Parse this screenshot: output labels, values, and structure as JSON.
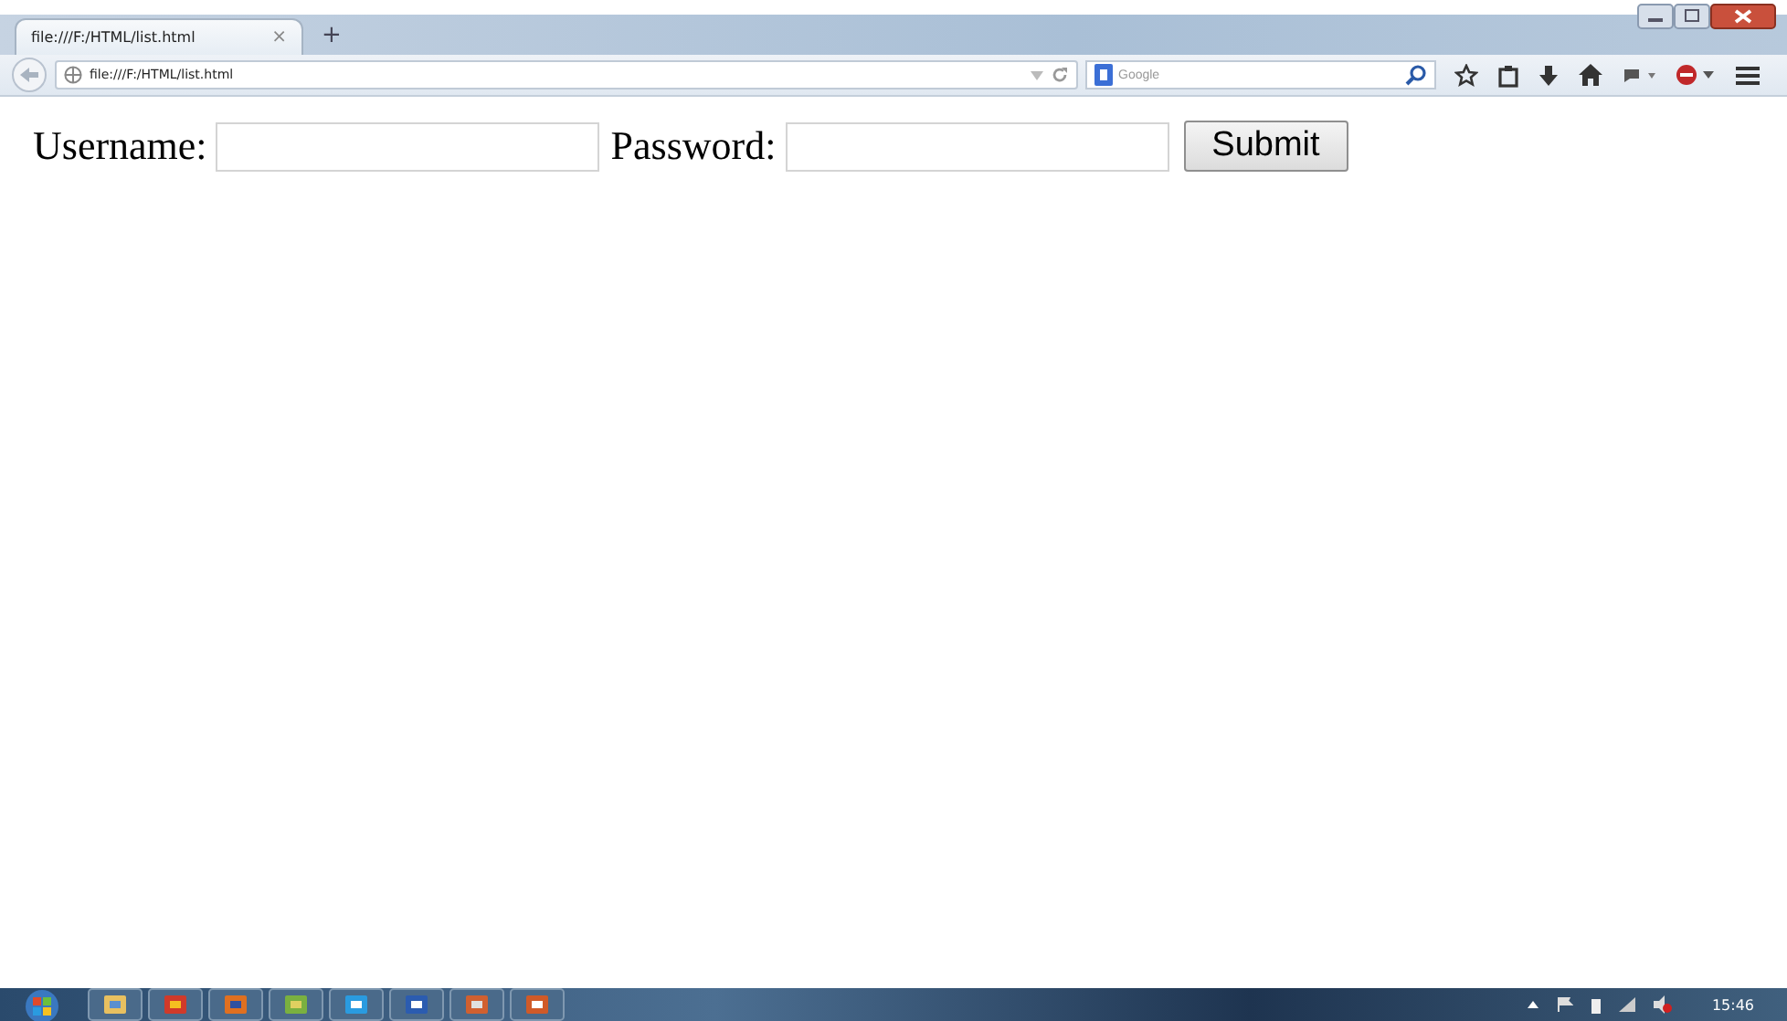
{
  "tab": {
    "title": "file:///F:/HTML/list.html",
    "close": "×",
    "new_tab": "+"
  },
  "address_bar": {
    "value": "file:///F:/HTML/list.html"
  },
  "search": {
    "placeholder": "Google"
  },
  "form": {
    "fields": [
      {
        "label": "Username:"
      },
      {
        "label": "Password:"
      }
    ],
    "submit": "Submit"
  },
  "taskbar": {
    "clock": "15:46"
  }
}
